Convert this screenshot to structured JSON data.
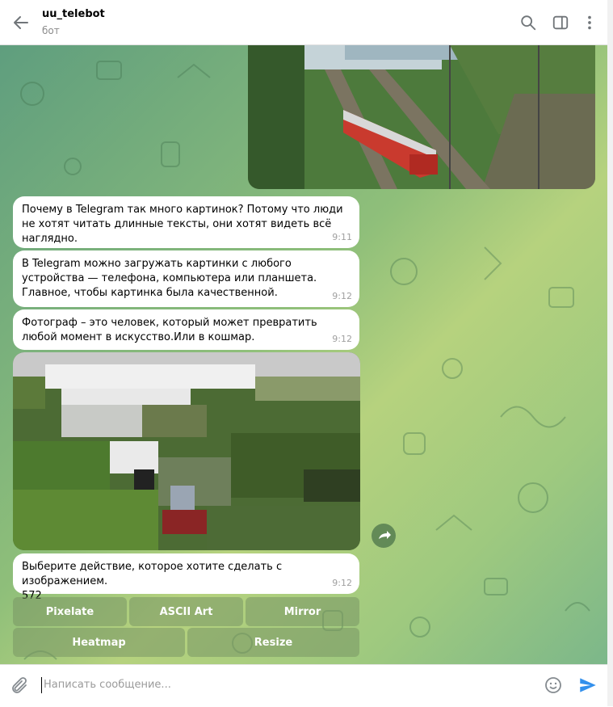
{
  "header": {
    "title": "uu_telebot",
    "subtitle": "бот"
  },
  "messages": [
    {
      "text": "Почему в Telegram так много картинок? Потому что люди не хотят читать длинные тексты, они хотят видеть всё наглядно.",
      "time": "9:11"
    },
    {
      "text": "В Telegram можно загружать картинки с любого устройства — телефона, компьютера или планшета. Главное, чтобы картинка была качественной.",
      "time": "9:12"
    },
    {
      "text": "Фотограф – это человек, который может превратить любой момент в искусство.Или в кошмар.",
      "time": "9:12"
    },
    {
      "text": "Выберите действие, которое хотите сделать с изображением.",
      "number": "572",
      "time": "9:12"
    }
  ],
  "keyboard": {
    "row1": [
      "Pixelate",
      "ASCII Art",
      "Mirror"
    ],
    "row2": [
      "Heatmap",
      "Resize"
    ]
  },
  "input": {
    "placeholder": "Написать сообщение..."
  },
  "colors": {
    "accent": "#3390ec",
    "bubble": "#ffffff",
    "chat_bg": "#8fbf7a"
  },
  "icons": [
    "back-arrow-icon",
    "search-icon",
    "sidebar-toggle-icon",
    "more-vertical-icon",
    "forward-icon",
    "attach-icon",
    "emoji-icon",
    "send-icon"
  ]
}
